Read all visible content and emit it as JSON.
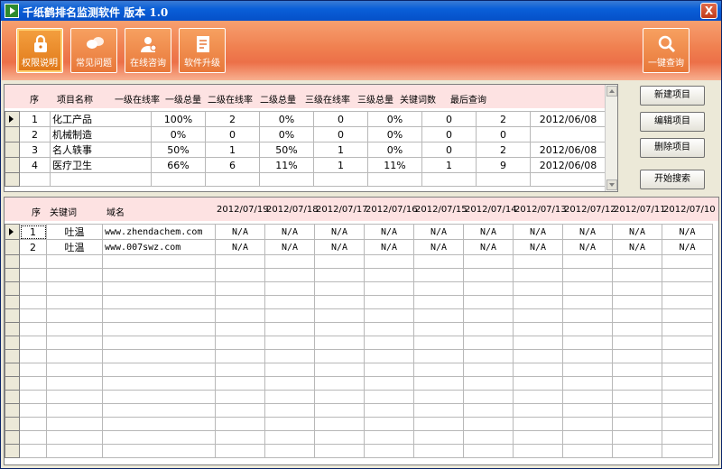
{
  "window": {
    "title": "千纸鹤排名监测软件  版本 1.0",
    "close_label": "X"
  },
  "toolbar": {
    "buttons": [
      {
        "label": "权限说明",
        "icon": "lock-icon"
      },
      {
        "label": "常见问题",
        "icon": "chat-bubbles-icon"
      },
      {
        "label": "在线咨询",
        "icon": "user-support-icon"
      },
      {
        "label": "软件升级",
        "icon": "document-upgrade-icon"
      }
    ],
    "query_button": {
      "label": "一键查询",
      "icon": "magnifier-icon"
    }
  },
  "projects": {
    "headers": [
      "序",
      "项目名称",
      "一级在线率",
      "一级总量",
      "二级在线率",
      "二级总量",
      "三级在线率",
      "三级总量",
      "关键词数",
      "最后查询"
    ],
    "rows": [
      [
        "1",
        "化工产品",
        "100%",
        "2",
        "0%",
        "0",
        "0%",
        "0",
        "2",
        "2012/06/08"
      ],
      [
        "2",
        "机械制造",
        "0%",
        "0",
        "0%",
        "0",
        "0%",
        "0",
        "0",
        ""
      ],
      [
        "3",
        "名人轶事",
        "50%",
        "1",
        "50%",
        "1",
        "0%",
        "0",
        "2",
        "2012/06/08"
      ],
      [
        "4",
        "医疗卫生",
        "66%",
        "6",
        "11%",
        "1",
        "11%",
        "1",
        "9",
        "2012/06/08"
      ]
    ]
  },
  "side_buttons": {
    "new_project": "新建项目",
    "edit_project": "编辑项目",
    "delete_project": "删除项目",
    "start_search": "开始搜索"
  },
  "keywords": {
    "headers": [
      "序",
      "关键词",
      "域名",
      "2012/07/19",
      "2012/07/18",
      "2012/07/17",
      "2012/07/16",
      "2012/07/15",
      "2012/07/14",
      "2012/07/13",
      "2012/07/12",
      "2012/07/11",
      "2012/07/10"
    ],
    "rows": [
      [
        "1",
        "吐温",
        "www.zhendachem.com",
        "N/A",
        "N/A",
        "N/A",
        "N/A",
        "N/A",
        "N/A",
        "N/A",
        "N/A",
        "N/A",
        "N/A"
      ],
      [
        "2",
        "吐温",
        "www.007swz.com",
        "N/A",
        "N/A",
        "N/A",
        "N/A",
        "N/A",
        "N/A",
        "N/A",
        "N/A",
        "N/A",
        "N/A"
      ]
    ]
  },
  "colors": {
    "titlebar": "#0550c8",
    "toolbar": "#f08050",
    "header_band": "#fde2e2"
  }
}
